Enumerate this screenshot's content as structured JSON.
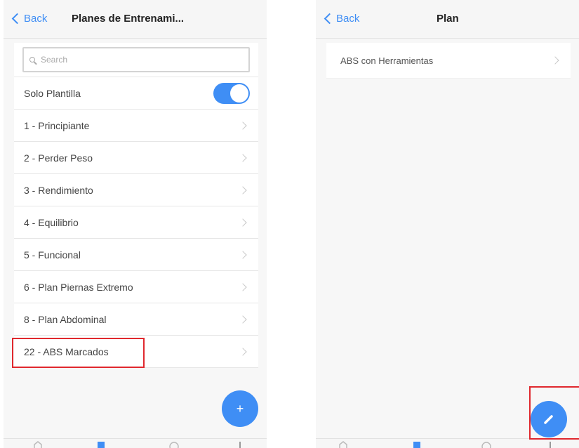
{
  "left": {
    "nav": {
      "back_label": "Back",
      "title": "Planes de Entrenami..."
    },
    "search": {
      "placeholder": "Search"
    },
    "toggle_row": {
      "label": "Solo Plantilla",
      "on": true
    },
    "plans": [
      {
        "label": "1 - Principiante"
      },
      {
        "label": "2 - Perder Peso"
      },
      {
        "label": "3 - Rendimiento"
      },
      {
        "label": "4 - Equilibrio"
      },
      {
        "label": "5 - Funcional"
      },
      {
        "label": "6 - Plan Piernas Extremo"
      },
      {
        "label": "8 - Plan Abdominal"
      },
      {
        "label": "22 - ABS Marcados"
      }
    ],
    "fab_icon": "plus-icon",
    "fab_symbol": "+"
  },
  "right": {
    "nav": {
      "back_label": "Back",
      "title": "Plan"
    },
    "items": [
      {
        "label": "ABS con Herramientas"
      }
    ],
    "fab_icon": "pencil-icon"
  },
  "colors": {
    "accent": "#3f8ef5",
    "highlight": "#e0282e",
    "separator": "#e6e6e6",
    "background": "#f7f7f7"
  },
  "tabbar_icons": [
    "home-icon",
    "calendar-icon",
    "clock-icon",
    "stats-icon"
  ]
}
